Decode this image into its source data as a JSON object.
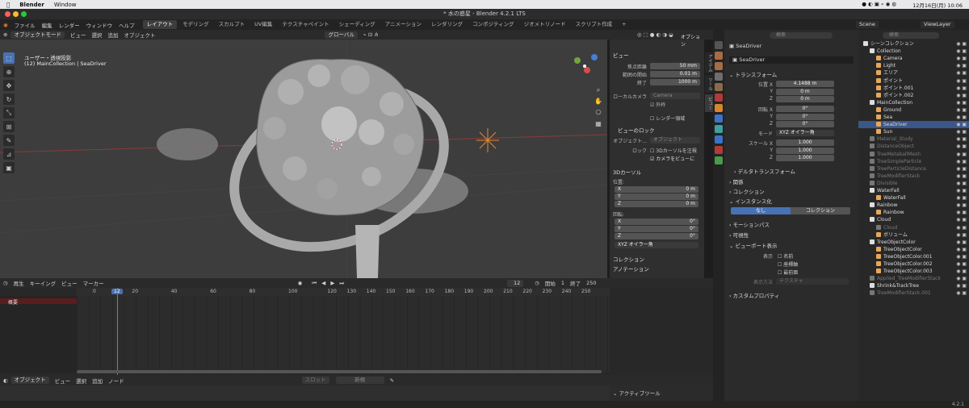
{
  "macbar": {
    "app": "Blender",
    "menu": "Window",
    "datetime": "12月16日(月) 10:06"
  },
  "window": {
    "title": "* 水の惑星 - Blender 4.2.1 LTS"
  },
  "topmenu": {
    "items": [
      "ファイル",
      "編集",
      "レンダー",
      "ウィンドウ",
      "ヘルプ"
    ],
    "tabs": [
      "レイアウト",
      "モデリング",
      "スカルプト",
      "UV編集",
      "テクスチャペイント",
      "シェーディング",
      "アニメーション",
      "レンダリング",
      "コンポジティング",
      "ジオメトリノード",
      "スクリプト作成"
    ],
    "scene": "Scene",
    "view_layer": "ViewLayer"
  },
  "vp_header": {
    "mode": "オブジェクトモード",
    "menus": [
      "ビュー",
      "選択",
      "追加",
      "オブジェクト"
    ],
    "orientation": "グローバル",
    "options": "オプション"
  },
  "viewport": {
    "info_line1": "ユーザー・透視投影",
    "info_line2": "(12) MainCollection | SeaDriver"
  },
  "npanel": {
    "view_header": "ビュー",
    "focal_label": "焦点距離",
    "focal_value": "50 mm",
    "clip_start_label": "範囲の開始",
    "clip_start_value": "0.01 m",
    "clip_end_label": "終了",
    "clip_end_value": "1000 m",
    "local_camera_label": "ローカルカメラ",
    "local_camera_value": "Camera",
    "outside_label": "外枠",
    "render_region_label": "レンダー領域",
    "view_lock_header": "ビューのロック",
    "lock_object_label": "オブジェクト...",
    "lock_object_placeholder": "オブジェクト",
    "lock_label": "ロック",
    "lock_cursor_label": "3Dカーソルを注視",
    "camera_to_view_label": "カメラをビューに",
    "cursor_header": "3Dカーソル",
    "location_label": "位置:",
    "loc_x": "0 m",
    "loc_y": "0 m",
    "loc_z": "0 m",
    "rotation_label": "回転:",
    "rot_x": "0°",
    "rot_y": "0°",
    "rot_z": "0°",
    "rotation_mode": "XYZ オイラー角",
    "collection_header": "コレクション",
    "annotation_header": "アノテーション",
    "tabs": [
      "アイテム",
      "ツール",
      "ビュー"
    ]
  },
  "properties": {
    "search_placeholder": "検索",
    "object_name": "SeaDriver",
    "object_data_name": "SeaDriver",
    "transform_header": "トランスフォーム",
    "location_label": "位置 X",
    "loc_x": "4.1488 m",
    "loc_y": "0 m",
    "loc_z": "0 m",
    "rotation_label": "回転 X",
    "rot_x": "0°",
    "rot_y": "0°",
    "rot_z": "0°",
    "mode_label": "モード",
    "mode_value": "XYZ オイラー角",
    "scale_label": "スケール X",
    "scale_x": "1.000",
    "scale_y": "1.000",
    "scale_z": "1.000",
    "delta_header": "デルタトランスフォーム",
    "relations_header": "関係",
    "collections_header": "コレクション",
    "instancing_header": "インスタンス化",
    "instancing_none": "なし",
    "instancing_collection": "コレクション",
    "motion_paths_header": "モーションパス",
    "visibility_header": "可視性",
    "viewport_display_header": "ビューポート表示",
    "show_label": "表示",
    "name_label": "名前",
    "axes_label": "座標軸",
    "in_front_label": "最前面",
    "display_as_label": "表示方法",
    "display_as_value": "テクスチャ",
    "custom_props_header": "カスタムプロパティ"
  },
  "outliner": {
    "search_placeholder": "検索",
    "items": [
      {
        "label": "シーンコレクション",
        "indent": 0,
        "icon": "#dddddd",
        "state": "normal"
      },
      {
        "label": "Collection",
        "indent": 1,
        "icon": "#dddddd",
        "state": "normal"
      },
      {
        "label": "Camera",
        "indent": 2,
        "icon": "#e8a65a",
        "state": "normal"
      },
      {
        "label": "Light",
        "indent": 2,
        "icon": "#e8a65a",
        "state": "normal"
      },
      {
        "label": "エリア",
        "indent": 2,
        "icon": "#e8a65a",
        "state": "normal"
      },
      {
        "label": "ポイント",
        "indent": 2,
        "icon": "#e8a65a",
        "state": "normal"
      },
      {
        "label": "ポイント.001",
        "indent": 2,
        "icon": "#e8a65a",
        "state": "normal"
      },
      {
        "label": "ポイント.002",
        "indent": 2,
        "icon": "#e8a65a",
        "state": "normal"
      },
      {
        "label": "MainCollection",
        "indent": 1,
        "icon": "#dddddd",
        "state": "normal"
      },
      {
        "label": "Ground",
        "indent": 2,
        "icon": "#e8a65a",
        "state": "normal"
      },
      {
        "label": "Sea",
        "indent": 2,
        "icon": "#e8a65a",
        "state": "normal"
      },
      {
        "label": "SeaDriver",
        "indent": 2,
        "icon": "#e8a65a",
        "state": "selected"
      },
      {
        "label": "Sun",
        "indent": 2,
        "icon": "#e8a65a",
        "state": "normal"
      },
      {
        "label": "Material_Study",
        "indent": 1,
        "icon": "#777777",
        "state": "dim"
      },
      {
        "label": "DistanceObject",
        "indent": 1,
        "icon": "#777777",
        "state": "dim"
      },
      {
        "label": "TreeMetaballMesh",
        "indent": 1,
        "icon": "#777777",
        "state": "dim"
      },
      {
        "label": "TreeSimpleParticle",
        "indent": 1,
        "icon": "#777777",
        "state": "dim"
      },
      {
        "label": "TreeParticleDistance",
        "indent": 1,
        "icon": "#777777",
        "state": "dim"
      },
      {
        "label": "TreeModifierStack",
        "indent": 1,
        "icon": "#777777",
        "state": "dim"
      },
      {
        "label": "Divisible",
        "indent": 1,
        "icon": "#777777",
        "state": "dim"
      },
      {
        "label": "WaterFall",
        "indent": 1,
        "icon": "#dddddd",
        "state": "normal"
      },
      {
        "label": "WaterFall",
        "indent": 2,
        "icon": "#e8a65a",
        "state": "normal"
      },
      {
        "label": "Rainbow",
        "indent": 1,
        "icon": "#dddddd",
        "state": "normal"
      },
      {
        "label": "Rainbow",
        "indent": 2,
        "icon": "#e8a65a",
        "state": "normal"
      },
      {
        "label": "Cloud",
        "indent": 1,
        "icon": "#dddddd",
        "state": "normal"
      },
      {
        "label": "Cloud",
        "indent": 2,
        "icon": "#777777",
        "state": "dim"
      },
      {
        "label": "ボリューム",
        "indent": 2,
        "icon": "#e8a65a",
        "state": "normal"
      },
      {
        "label": "TreeObjectColor",
        "indent": 1,
        "icon": "#dddddd",
        "state": "normal"
      },
      {
        "label": "TreeObjectColor",
        "indent": 2,
        "icon": "#e8a65a",
        "state": "normal"
      },
      {
        "label": "TreeObjectColor.001",
        "indent": 2,
        "icon": "#e8a65a",
        "state": "normal"
      },
      {
        "label": "TreeObjectColor.002",
        "indent": 2,
        "icon": "#e8a65a",
        "state": "normal"
      },
      {
        "label": "TreeObjectColor.003",
        "indent": 2,
        "icon": "#e8a65a",
        "state": "normal"
      },
      {
        "label": "Applied_TreeModifierStack",
        "indent": 1,
        "icon": "#777777",
        "state": "dim"
      },
      {
        "label": "Shrink&TrackTree",
        "indent": 1,
        "icon": "#dddddd",
        "state": "normal"
      },
      {
        "label": "TreeModifierStack.001",
        "indent": 1,
        "icon": "#777777",
        "state": "dim"
      }
    ]
  },
  "timeline_header": {
    "playback": "再生",
    "keying": "キーイング",
    "view": "ビュー",
    "marker": "マーカー",
    "current_frame": "12",
    "start_label": "開始",
    "start_value": "1",
    "end_label": "終了",
    "end_value": "250"
  },
  "timeline": {
    "summary": "概要",
    "ticks": [
      "0",
      "20",
      "40",
      "60",
      "80",
      "100",
      "120",
      "130",
      "140",
      "150",
      "160",
      "170",
      "180",
      "190",
      "200",
      "210",
      "220",
      "230",
      "240",
      "250"
    ],
    "cursor": "12"
  },
  "node_header": {
    "mode": "オブジェクト",
    "menus": [
      "ビュー",
      "選択",
      "追加",
      "ノード"
    ],
    "slot": "スロット",
    "new_button": "新規"
  },
  "active_tool": {
    "header": "アクティブツール"
  },
  "statusbar": {
    "version": "4.2.1"
  }
}
